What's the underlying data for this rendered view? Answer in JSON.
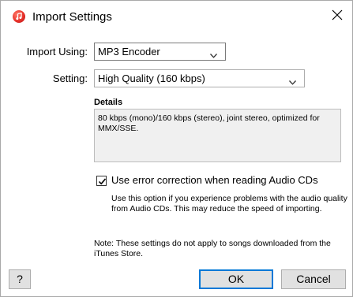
{
  "window": {
    "title": "Import Settings"
  },
  "form": {
    "import_using_label": "Import Using:",
    "import_using_value": "MP3 Encoder",
    "setting_label": "Setting:",
    "setting_value": "High Quality (160 kbps)"
  },
  "details": {
    "title": "Details",
    "text": "80 kbps (mono)/160 kbps (stereo), joint stereo, optimized for MMX/SSE."
  },
  "error_correction": {
    "checked": true,
    "label": "Use error correction when reading Audio CDs",
    "help": "Use this option if you experience problems with the audio quality from Audio CDs.  This may reduce the speed of importing."
  },
  "note": "Note: These settings do not apply to songs downloaded from the iTunes Store.",
  "buttons": {
    "help": "?",
    "ok": "OK",
    "cancel": "Cancel"
  },
  "colors": {
    "default_button_border": "#0078d7",
    "button_face": "#e1e1e1"
  }
}
